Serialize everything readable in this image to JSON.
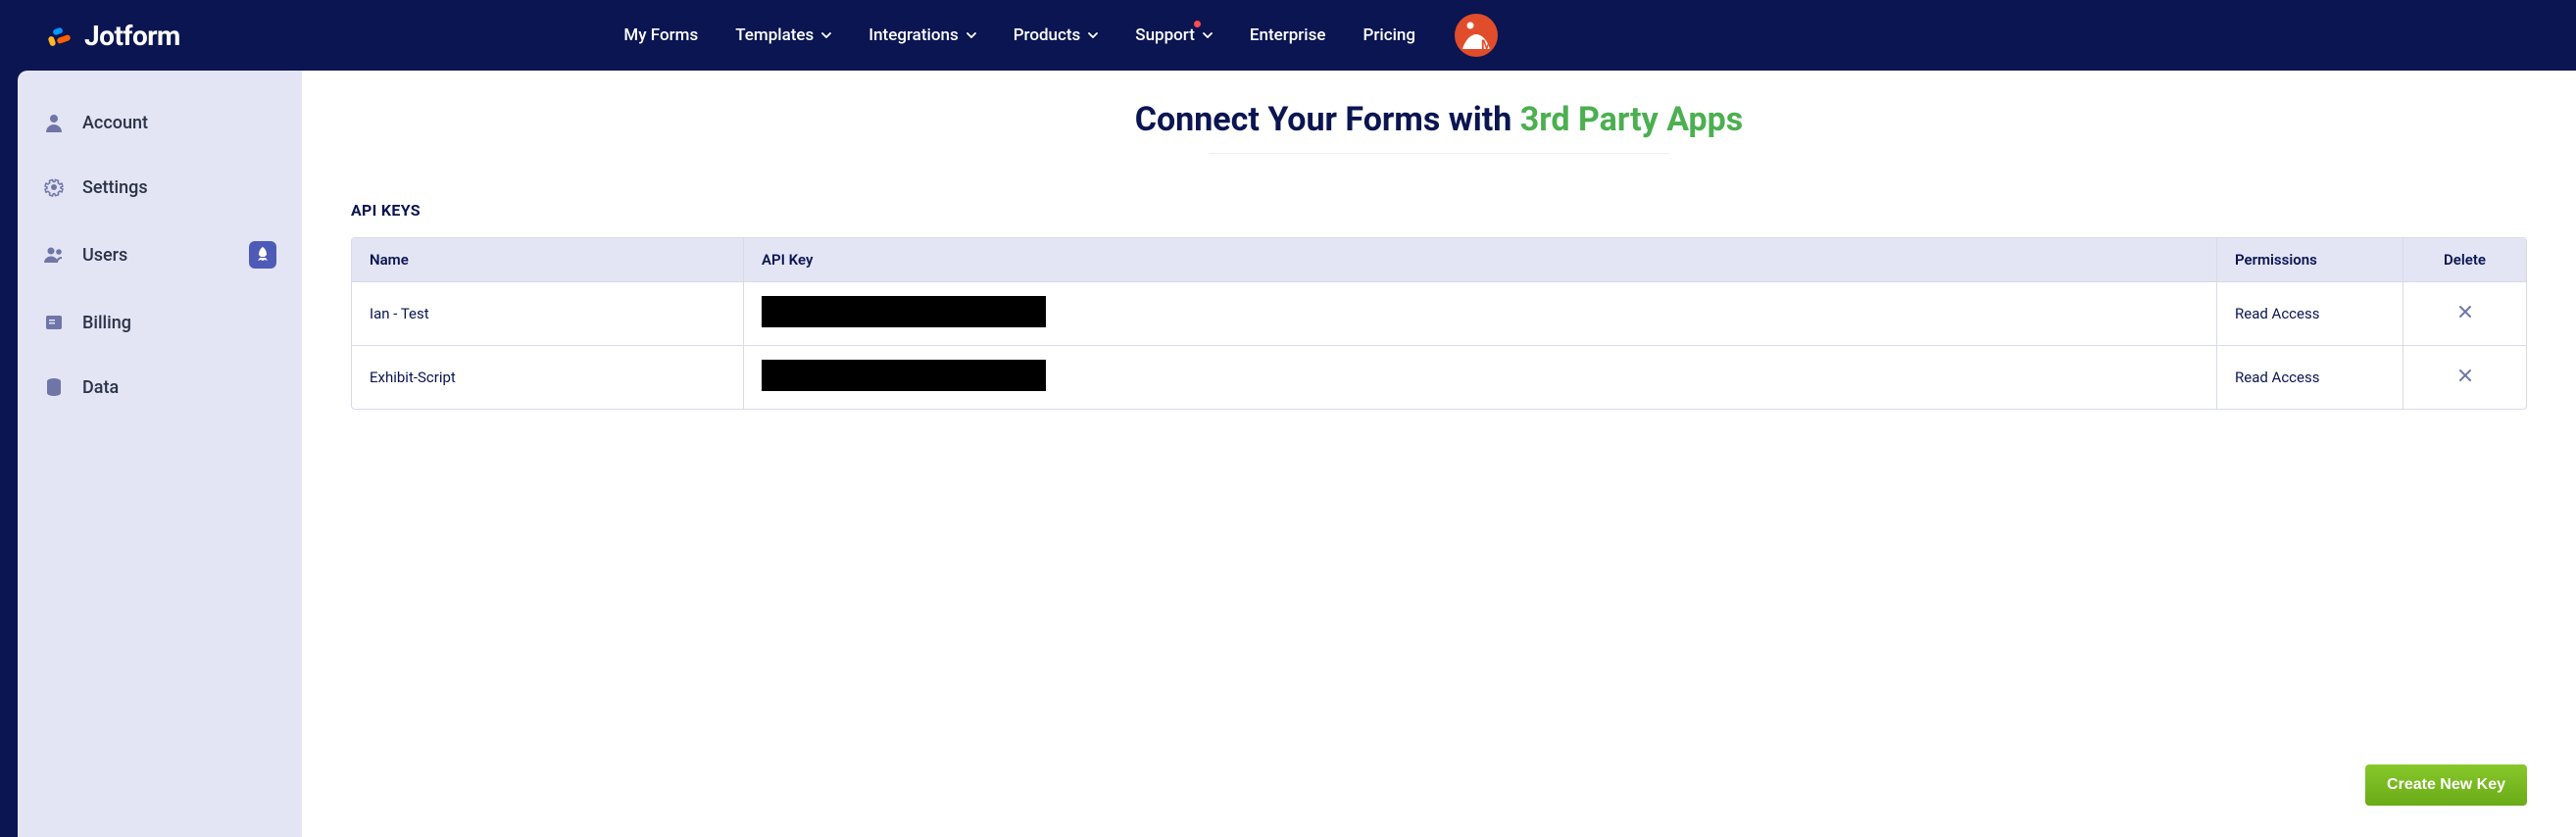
{
  "brand": {
    "name": "Jotform"
  },
  "nav": {
    "my_forms": "My Forms",
    "templates": "Templates",
    "integrations": "Integrations",
    "products": "Products",
    "support": "Support",
    "enterprise": "Enterprise",
    "pricing": "Pricing"
  },
  "sidebar": {
    "account": "Account",
    "settings": "Settings",
    "users": "Users",
    "billing": "Billing",
    "data": "Data"
  },
  "page": {
    "title_a": "Connect Your Forms with ",
    "title_b": "3rd Party Apps",
    "section": "API KEYS"
  },
  "table": {
    "headers": {
      "name": "Name",
      "key": "API Key",
      "perm": "Permissions",
      "del": "Delete"
    },
    "rows": [
      {
        "name": "Ian - Test",
        "perm": "Read Access"
      },
      {
        "name": "Exhibit-Script",
        "perm": "Read Access"
      }
    ]
  },
  "buttons": {
    "create": "Create New Key"
  }
}
